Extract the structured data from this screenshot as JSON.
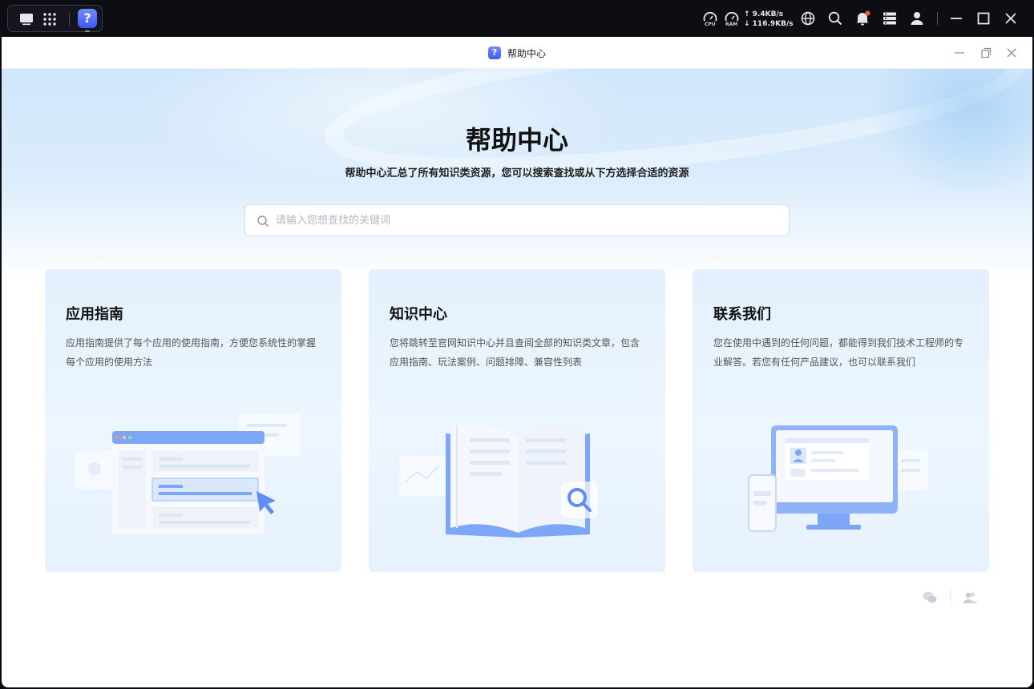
{
  "os": {
    "apps": [
      {
        "icon": "desktop-icon"
      },
      {
        "icon": "app-grid-icon"
      },
      {
        "icon": "help-center-app-icon",
        "glyph": "?"
      }
    ],
    "tray": {
      "cpu_label": "CPU",
      "ram_label": "RAM",
      "upload": "↑ 9.4KB/s",
      "download": "↓ 116.9KB/s",
      "icons": [
        "globe-icon",
        "search-icon",
        "bell-icon",
        "server-icon",
        "user-icon",
        "minimize-icon",
        "maximize-icon",
        "close-icon"
      ],
      "notification_color": "#ff5a3c"
    }
  },
  "window": {
    "title": "帮助中心",
    "icon_glyph": "?"
  },
  "hero": {
    "title": "帮助中心",
    "subtitle": "帮助中心汇总了所有知识类资源，您可以搜索查找或从下方选择合适的资源",
    "search_placeholder": "请输入您想查找的关键词",
    "search_value": ""
  },
  "cards": [
    {
      "title": "应用指南",
      "desc": "应用指南提供了每个应用的使用指南，方便您系统性的掌握每个应用的使用方法",
      "illustration": "app-guide-illustration"
    },
    {
      "title": "知识中心",
      "desc": "您将跳转至官网知识中心并且查阅全部的知识类文章，包含应用指南、玩法案例、问题排障、兼容性列表",
      "illustration": "knowledge-book-illustration"
    },
    {
      "title": "联系我们",
      "desc": "您在使用中遇到的任何问题，都能得到我们技术工程师的专业解答。若您有任何产品建议，也可以联系我们",
      "illustration": "contact-computer-illustration"
    }
  ],
  "footer": {
    "icons": [
      "wechat-icon",
      "community-icon"
    ]
  },
  "colors": {
    "accent": "#4f6ff5",
    "illustration_blue": "#7da6f7",
    "hero_bg": "#d3e8fb"
  }
}
